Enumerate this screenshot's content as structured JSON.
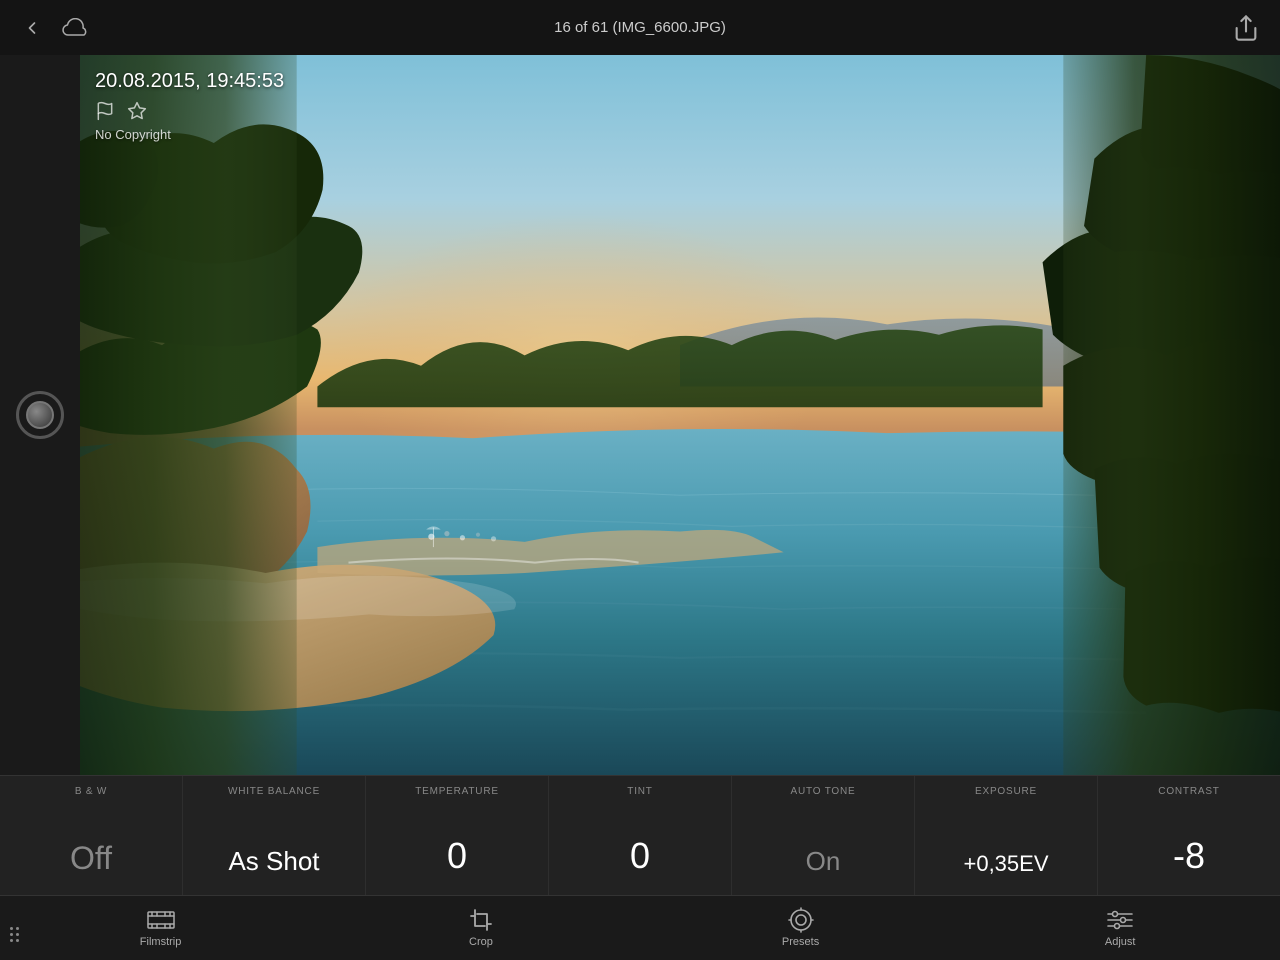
{
  "header": {
    "title": "16 of 61 (IMG_6600.JPG)",
    "back_label": "back",
    "cloud_label": "cloud",
    "share_label": "share"
  },
  "photo": {
    "date": "20.08.2015, 19:45:53",
    "copyright": "No Copyright",
    "flag_icon": "flag",
    "star_icon": "star"
  },
  "controls": [
    {
      "label": "B & W",
      "value": "Off",
      "style": "dimmed"
    },
    {
      "label": "WHITE BALANCE",
      "value": "As Shot",
      "style": "medium"
    },
    {
      "label": "TEMPERATURE",
      "value": "0",
      "style": "large"
    },
    {
      "label": "TINT",
      "value": "0",
      "style": "large"
    },
    {
      "label": "AUTO TONE",
      "value": "On",
      "style": "dimmed medium"
    },
    {
      "label": "EXPOSURE",
      "value": "+0,35EV",
      "style": "small"
    },
    {
      "label": "CONTRAST",
      "value": "-8",
      "style": "large"
    }
  ],
  "nav": [
    {
      "label": "Filmstrip",
      "icon": "filmstrip"
    },
    {
      "label": "Crop",
      "icon": "crop"
    },
    {
      "label": "Presets",
      "icon": "presets"
    },
    {
      "label": "Adjust",
      "icon": "adjust"
    }
  ]
}
